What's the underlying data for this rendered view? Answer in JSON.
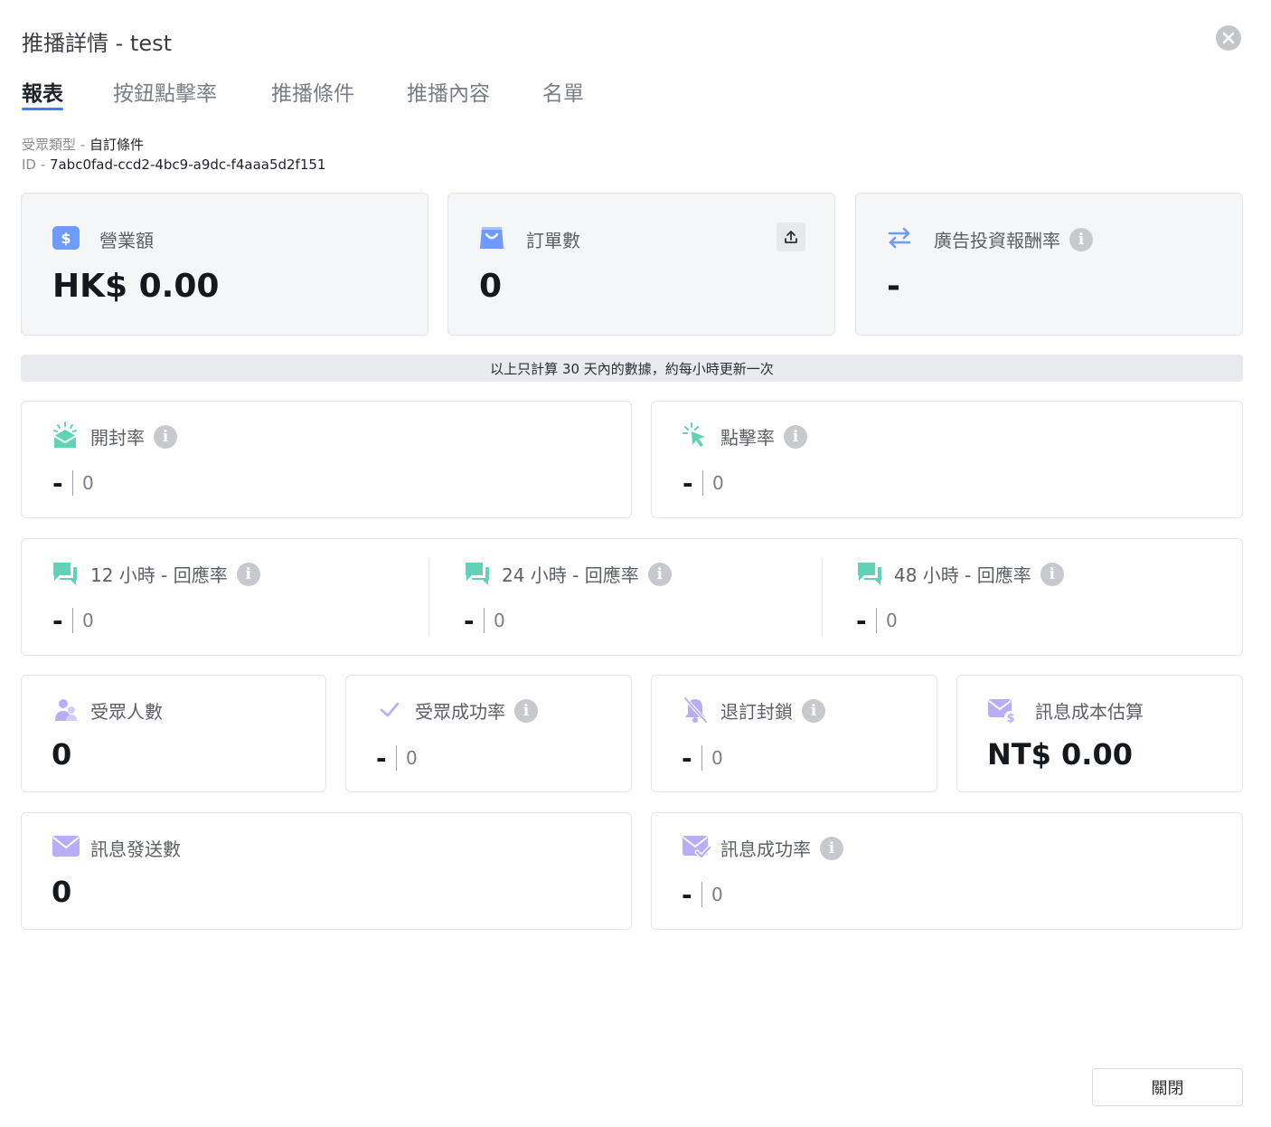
{
  "dialog": {
    "title": "推播詳情 - test",
    "close_icon": "close-circle-icon"
  },
  "tabs": [
    {
      "label": "報表",
      "active": true
    },
    {
      "label": "按鈕點擊率",
      "active": false
    },
    {
      "label": "推播條件",
      "active": false
    },
    {
      "label": "推播內容",
      "active": false
    },
    {
      "label": "名單",
      "active": false
    }
  ],
  "meta": {
    "audience_type_label": "受眾類型 - ",
    "audience_type_value": "自訂條件",
    "id_label": "ID - ",
    "id_value": "7abc0fad-ccd2-4bc9-a9dc-f4aaa5d2f151"
  },
  "top_cards": {
    "revenue": {
      "label": "營業額",
      "value": "HK$ 0.00",
      "icon": "dollar-icon"
    },
    "orders": {
      "label": "訂單數",
      "value": "0",
      "icon": "shopping-bag-icon",
      "action_icon": "upload-icon"
    },
    "roas": {
      "label": "廣告投資報酬率",
      "value": "-",
      "icon": "swap-arrows-icon"
    }
  },
  "notice": "以上只計算 30 天內的數據，約每小時更新一次",
  "rates": {
    "open": {
      "label": "開封率",
      "value": "-",
      "count": "0",
      "icon": "open-mail-icon"
    },
    "click": {
      "label": "點擊率",
      "value": "-",
      "count": "0",
      "icon": "cursor-click-icon"
    }
  },
  "response": [
    {
      "label": "12 小時 - 回應率",
      "value": "-",
      "count": "0",
      "icon": "chat-bubbles-icon"
    },
    {
      "label": "24 小時 - 回應率",
      "value": "-",
      "count": "0",
      "icon": "chat-bubbles-icon"
    },
    {
      "label": "48 小時 - 回應率",
      "value": "-",
      "count": "0",
      "icon": "chat-bubbles-icon"
    }
  ],
  "audience": {
    "people": {
      "label": "受眾人數",
      "value": "0",
      "icon": "users-icon"
    },
    "success": {
      "label": "受眾成功率",
      "value": "-",
      "count": "0",
      "icon": "check-icon"
    },
    "unsub": {
      "label": "退訂封鎖",
      "value": "-",
      "count": "0",
      "icon": "bell-off-icon"
    },
    "cost": {
      "label": "訊息成本估算",
      "value": "NT$ 0.00",
      "icon": "mail-dollar-icon"
    }
  },
  "messages": {
    "sent": {
      "label": "訊息發送數",
      "value": "0",
      "icon": "mail-icon"
    },
    "success": {
      "label": "訊息成功率",
      "value": "-",
      "count": "0",
      "icon": "mail-check-icon"
    }
  },
  "footer": {
    "close_label": "關閉"
  },
  "colors": {
    "accent": "#3b82f6",
    "teal": "#5fd3b5",
    "purple": "#b9aef5",
    "blue_icon": "#6f9bff"
  }
}
